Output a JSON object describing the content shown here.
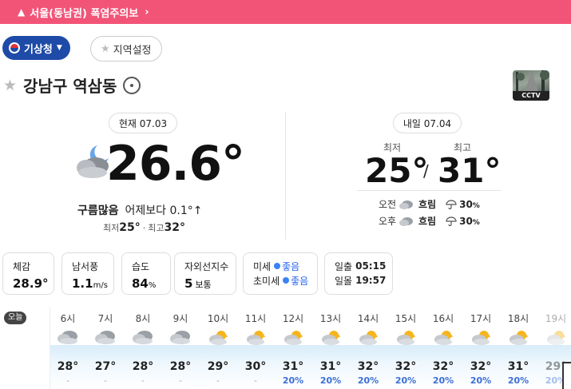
{
  "alert": {
    "warn_icon": "warning-triangle-icon",
    "text": "서울(동남권) 폭염주의보",
    "chevron": "chevron-right-icon",
    "color": "#f25478"
  },
  "source_button": {
    "label": "기상청",
    "color": "#1e4aa8"
  },
  "region_button": {
    "label": "지역설정"
  },
  "location": {
    "name": "강남구 역삼동"
  },
  "cctv": {
    "label": "CCTV"
  },
  "current": {
    "badge": "현재 07.03",
    "temp": "26.6°",
    "condition": "구름많음",
    "compare": "어제보다 0.1°↑",
    "min_label": "최저",
    "min": "25°",
    "sep": "·",
    "max_label": "최고",
    "max": "32°"
  },
  "tomorrow": {
    "badge": "내일 07.04",
    "min_label": "최저",
    "max_label": "최고",
    "min": "25°",
    "slash": "/",
    "max": "31°",
    "am": {
      "label": "오전",
      "condition": "흐림",
      "pct": "30",
      "unit": "%"
    },
    "pm": {
      "label": "오후",
      "condition": "흐림",
      "pct": "30",
      "unit": "%"
    }
  },
  "details": {
    "feels": {
      "title": "체감",
      "value": "28.9°"
    },
    "wind": {
      "title": "남서풍",
      "value": "1.1",
      "unit": "m/s"
    },
    "humidity": {
      "title": "습도",
      "value": "84",
      "unit": "%"
    },
    "uv": {
      "title": "자외선지수",
      "value": "5",
      "level": "보통"
    },
    "dust": {
      "pm10_label": "미세",
      "pm10_level": "좋음",
      "pm25_label": "초미세",
      "pm25_level": "좋음"
    },
    "sun": {
      "rise_label": "일출",
      "rise": "05:15",
      "set_label": "일몰",
      "set": "19:57"
    }
  },
  "hourly": {
    "today_label": "오늘",
    "hours": [
      {
        "time": "6시",
        "icon": "cloudy",
        "temp": "28°",
        "pct": "-"
      },
      {
        "time": "7시",
        "icon": "cloudy",
        "temp": "27°",
        "pct": "-"
      },
      {
        "time": "8시",
        "icon": "cloudy",
        "temp": "28°",
        "pct": "-"
      },
      {
        "time": "9시",
        "icon": "cloudy",
        "temp": "28°",
        "pct": "-"
      },
      {
        "time": "10시",
        "icon": "partly-cloudy",
        "temp": "29°",
        "pct": "-"
      },
      {
        "time": "11시",
        "icon": "partly-cloudy",
        "temp": "30°",
        "pct": "-"
      },
      {
        "time": "12시",
        "icon": "partly-cloudy",
        "temp": "31°",
        "pct": "20%"
      },
      {
        "time": "13시",
        "icon": "partly-cloudy",
        "temp": "31°",
        "pct": "20%"
      },
      {
        "time": "14시",
        "icon": "partly-cloudy",
        "temp": "32°",
        "pct": "20%"
      },
      {
        "time": "15시",
        "icon": "partly-cloudy",
        "temp": "32°",
        "pct": "20%"
      },
      {
        "time": "16시",
        "icon": "partly-cloudy",
        "temp": "32°",
        "pct": "20%"
      },
      {
        "time": "17시",
        "icon": "partly-cloudy",
        "temp": "32°",
        "pct": "20%"
      },
      {
        "time": "18시",
        "icon": "partly-cloudy",
        "temp": "31°",
        "pct": "20%"
      },
      {
        "time": "19시",
        "icon": "partly-cloudy",
        "temp": "29°",
        "pct": "20%"
      }
    ]
  }
}
